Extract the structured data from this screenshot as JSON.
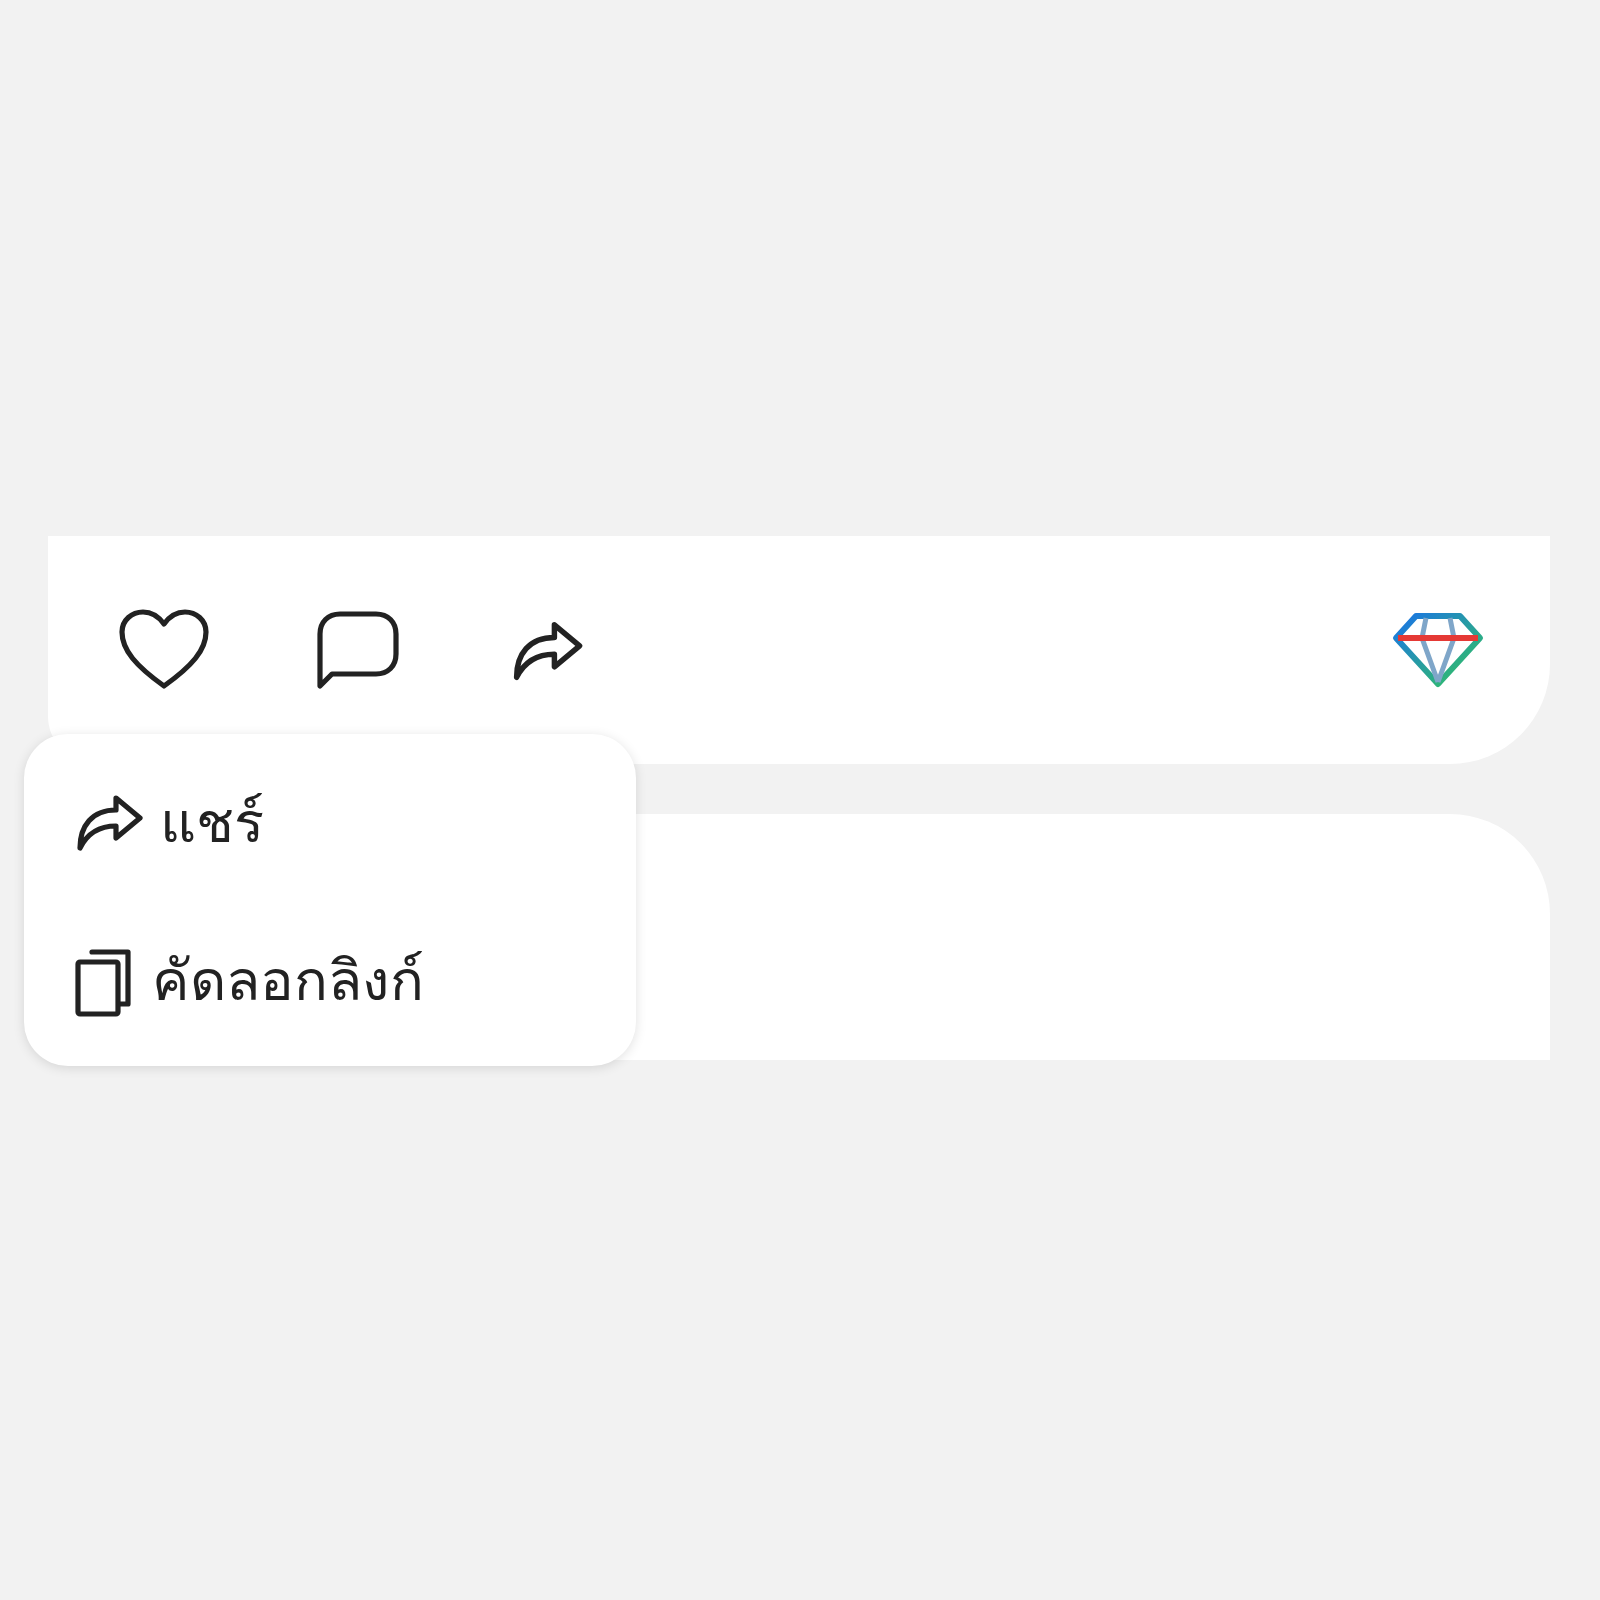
{
  "share_menu": {
    "items": [
      {
        "kind": "share",
        "label": "แชร์"
      },
      {
        "kind": "copy",
        "label": "คัดลอกลิงก์"
      }
    ]
  }
}
